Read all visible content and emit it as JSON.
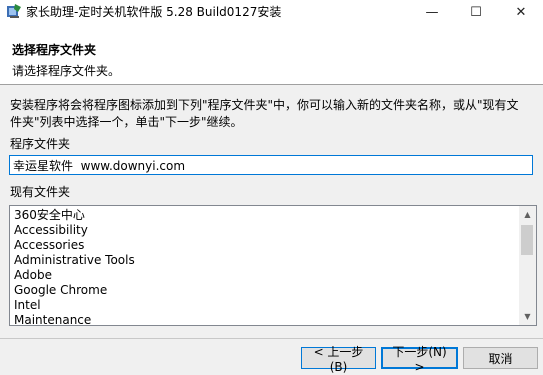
{
  "window": {
    "title": "家长助理-定时关机软件版 5.28 Build0127安装",
    "minimize_glyph": "—",
    "maximize_glyph": "☐",
    "close_glyph": "✕",
    "app_icon": "installer-icon"
  },
  "header": {
    "title": "选择程序文件夹",
    "subtitle": "请选择程序文件夹。"
  },
  "body": {
    "instruction": "安装程序将会将程序图标添加到下列\"程序文件夹\"中，你可以输入新的文件夹名称，或从\"现有文件夹\"列表中选择一个，单击\"下一步\"继续。",
    "folder_label": "程序文件夹",
    "folder_value": "幸运星软件  www.downyi.com",
    "existing_label": "现有文件夹",
    "existing_folders": [
      "360安全中心",
      "Accessibility",
      "Accessories",
      "Administrative Tools",
      "Adobe",
      "Google Chrome",
      "Intel",
      "Maintenance"
    ],
    "scroll_up_glyph": "▲",
    "scroll_down_glyph": "▼"
  },
  "buttons": {
    "back": "< 上一步(B)",
    "next": "下一步(N) >",
    "cancel": "取消"
  },
  "colors": {
    "accent": "#0078d7",
    "dialog_bg": "#f0f0f0"
  }
}
